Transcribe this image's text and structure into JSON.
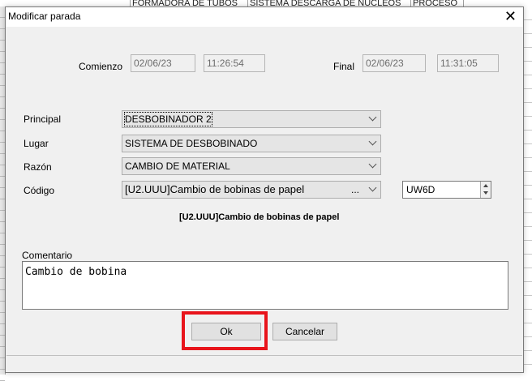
{
  "background": {
    "columns": [
      "",
      "FORMADORA DE TUBOS",
      "SISTEMA DESCARGA DE NUCLEOS",
      "PROCESO"
    ]
  },
  "dialog": {
    "title": "Modificar parada",
    "close_glyph": "✕",
    "comienzo_label": "Comienzo",
    "comienzo_date": "02/06/23",
    "comienzo_time": "11:26:54",
    "final_label": "Final",
    "final_date": "02/06/23",
    "final_time": "11:31:05",
    "principal_label": "Principal",
    "principal_value": "DESBOBINADOR 2",
    "lugar_label": "Lugar",
    "lugar_value": "SISTEMA DE DESBOBINADO",
    "razon_label": "Razón",
    "razon_value": "CAMBIO DE MATERIAL",
    "codigo_label": "Código",
    "codigo_value": "[U2.UUU]Cambio de bobinas de papel",
    "codigo_dots": "...",
    "code_spin_value": "UW6D",
    "codigo_description": "[U2.UUU]Cambio de bobinas de papel",
    "comentario_label": "Comentario",
    "comentario_value": "Cambio de bobina",
    "ok_label": "Ok",
    "cancel_label": "Cancelar"
  },
  "colors": {
    "highlight": "#e8141b",
    "dialog_bg": "#f0f0f0"
  }
}
